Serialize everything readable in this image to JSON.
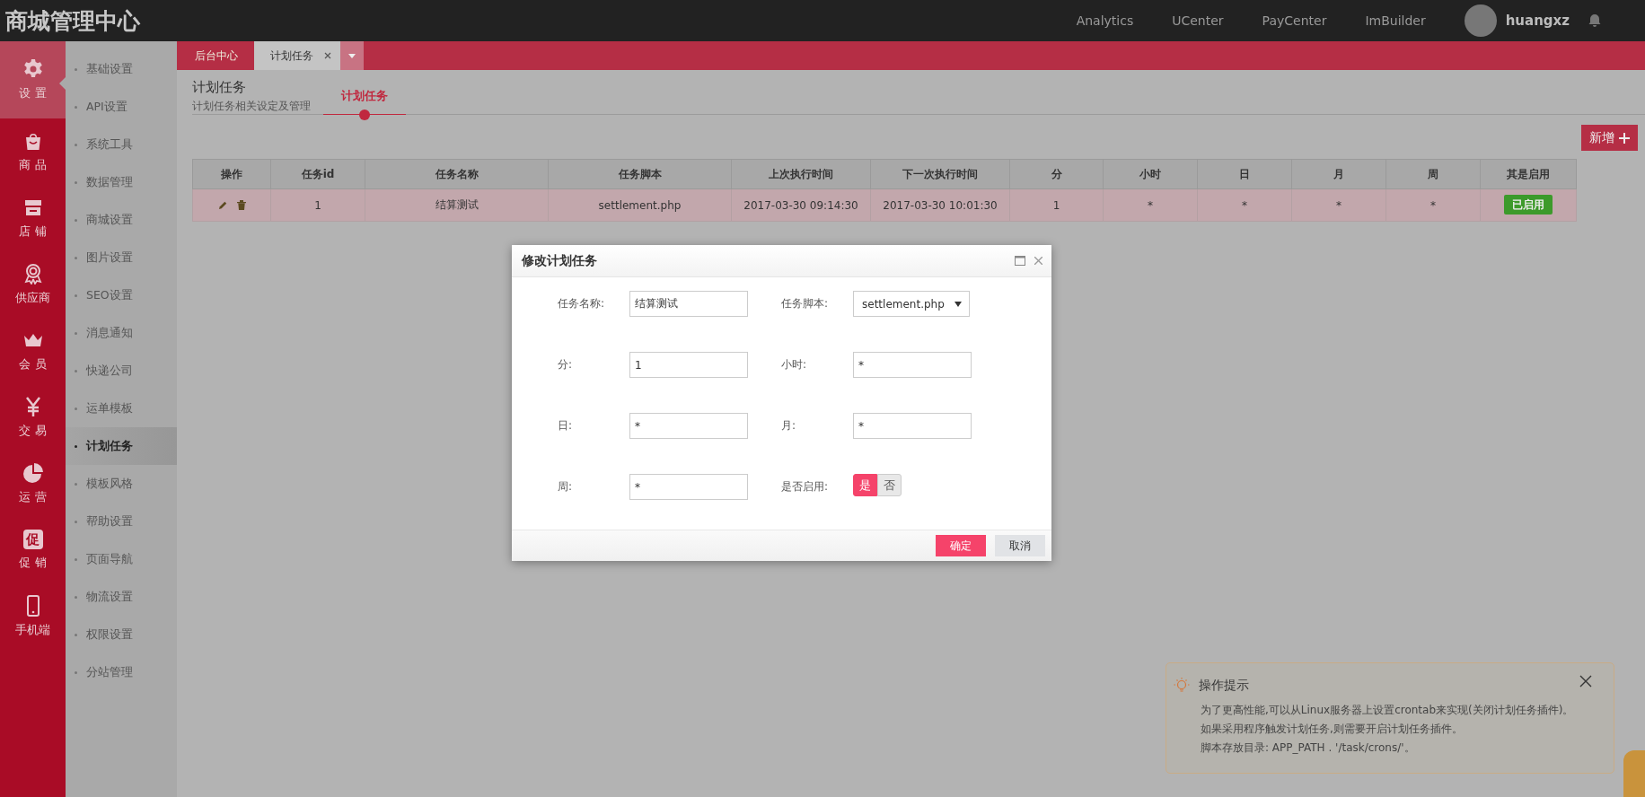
{
  "header": {
    "title": "商城管理中心",
    "nav_links": [
      "Analytics",
      "UCenter",
      "PayCenter",
      "ImBuilder"
    ],
    "user_name": "huangxz"
  },
  "icon_sidebar": [
    {
      "kind": "gear",
      "label": "设 置",
      "selected": true
    },
    {
      "kind": "bag",
      "label": "商 品",
      "selected": false
    },
    {
      "kind": "shop",
      "label": "店 铺",
      "selected": false
    },
    {
      "kind": "medal",
      "label": "供应商",
      "selected": false
    },
    {
      "kind": "crown",
      "label": "会 员",
      "selected": false
    },
    {
      "kind": "yen",
      "label": "交 易",
      "selected": false
    },
    {
      "kind": "pie",
      "label": "运 营",
      "selected": false
    },
    {
      "kind": "glyph",
      "glyph": "促",
      "label": "促 销",
      "selected": false
    },
    {
      "kind": "phone",
      "label": "手机端",
      "selected": false
    }
  ],
  "submenu": [
    {
      "label": "基础设置",
      "selected": false
    },
    {
      "label": "API设置",
      "selected": false
    },
    {
      "label": "系统工具",
      "selected": false
    },
    {
      "label": "数据管理",
      "selected": false
    },
    {
      "label": "商城设置",
      "selected": false
    },
    {
      "label": "图片设置",
      "selected": false
    },
    {
      "label": "SEO设置",
      "selected": false
    },
    {
      "label": "消息通知",
      "selected": false
    },
    {
      "label": "快递公司",
      "selected": false
    },
    {
      "label": "运单模板",
      "selected": false
    },
    {
      "label": "计划任务",
      "selected": true
    },
    {
      "label": "模板风格",
      "selected": false
    },
    {
      "label": "帮助设置",
      "selected": false
    },
    {
      "label": "页面导航",
      "selected": false
    },
    {
      "label": "物流设置",
      "selected": false
    },
    {
      "label": "权限设置",
      "selected": false
    },
    {
      "label": "分站管理",
      "selected": false
    }
  ],
  "tabs": [
    {
      "label": "后台中心",
      "selected": false,
      "closable": false
    },
    {
      "label": "计划任务",
      "selected": true,
      "closable": true
    }
  ],
  "page": {
    "title": "计划任务",
    "subtitle": "计划任务相关设定及管理",
    "subtabs": [
      {
        "label": "计划任务",
        "selected": true
      }
    ],
    "add_button": "新增"
  },
  "table": {
    "columns": [
      "操作",
      "任务id",
      "任务名称",
      "任务脚本",
      "上次执行时间",
      "下一次执行时间",
      "分",
      "小时",
      "日",
      "月",
      "周",
      "其是启用"
    ],
    "rows": [
      {
        "selected": true,
        "cells": [
          "",
          "1",
          "结算测试",
          "settlement.php",
          "2017-03-30 09:14:30",
          "2017-03-30 10:01:30",
          "1",
          "*",
          "*",
          "*",
          "*"
        ],
        "status": "已启用"
      }
    ]
  },
  "dialog": {
    "title": "修改计划任务",
    "fields": [
      {
        "kind": "text",
        "label": "任务名称:",
        "value": "结算测试"
      },
      {
        "kind": "select",
        "label": "任务脚本:",
        "value": "settlement.php"
      },
      {
        "kind": "text",
        "label": "分:",
        "value": "1"
      },
      {
        "kind": "text",
        "label": "小时:",
        "value": "*"
      },
      {
        "kind": "text",
        "label": "日:",
        "value": "*"
      },
      {
        "kind": "text",
        "label": "月:",
        "value": "*"
      },
      {
        "kind": "text",
        "label": "周:",
        "value": "*"
      },
      {
        "kind": "toggle",
        "label": "是否启用:",
        "options": [
          {
            "label": "是",
            "selected": true
          },
          {
            "label": "否",
            "selected": false
          }
        ]
      }
    ],
    "buttons": [
      {
        "kind": "primary",
        "label": "确定"
      },
      {
        "kind": "secondary",
        "label": "取消"
      }
    ]
  },
  "tip": {
    "title": "操作提示",
    "lines": [
      "为了更高性能,可以从Linux服务器上设置crontab来实现(关闭计划任务插件)。",
      "如果采用程序触发计划任务,则需要开启计划任务插件。",
      "脚本存放目录: APP_PATH . '/task/crons/'。"
    ]
  }
}
